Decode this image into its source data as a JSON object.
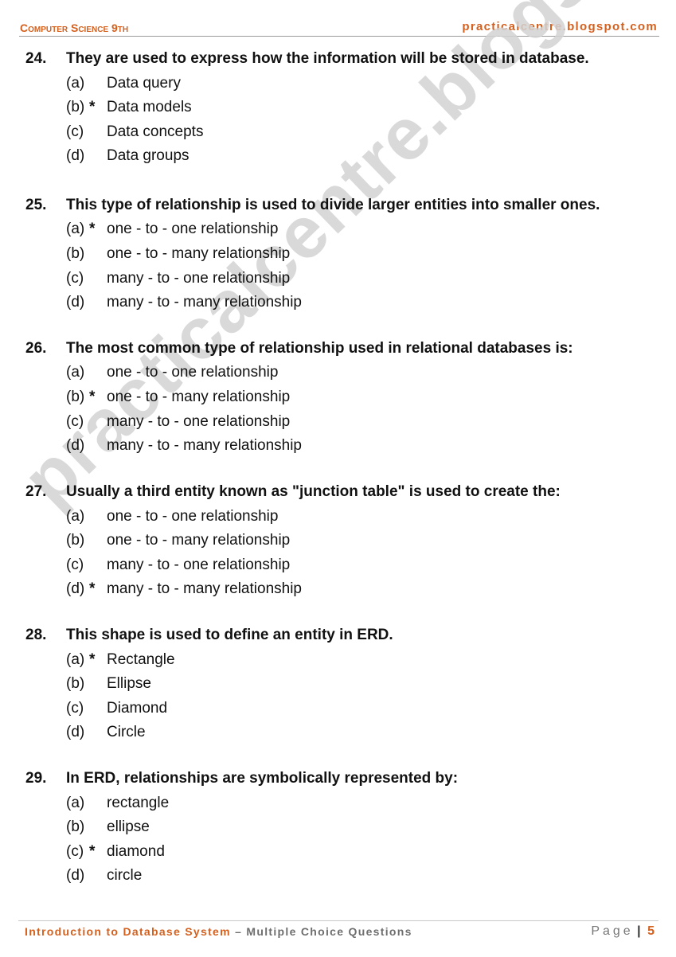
{
  "header": {
    "subject": "Computer Science 9th",
    "website": "practicalcentre.blogspot.com"
  },
  "watermark": "practicalcentre.blogspot.com",
  "colors": {
    "accent": "#d4601e",
    "text": "#111111",
    "muted": "#6e6e6e",
    "watermark": "#d3d3d3"
  },
  "questions": [
    {
      "number": "24.",
      "text": "They are used to express how the information will be stored in database.",
      "options": [
        {
          "label": "(a)",
          "marker": "",
          "text": "Data query"
        },
        {
          "label": "(b)",
          "marker": "*",
          "text": "Data models"
        },
        {
          "label": "(c)",
          "marker": "",
          "text": "Data concepts"
        },
        {
          "label": "(d)",
          "marker": "",
          "text": "Data groups"
        }
      ]
    },
    {
      "number": "25.",
      "text": "This type of relationship is used to divide larger entities into smaller ones.",
      "options": [
        {
          "label": "(a)",
          "marker": "*",
          "text": "one - to - one relationship"
        },
        {
          "label": "(b)",
          "marker": "",
          "text": "one - to - many relationship"
        },
        {
          "label": "(c)",
          "marker": "",
          "text": "many - to - one relationship"
        },
        {
          "label": "(d)",
          "marker": "",
          "text": "many - to - many relationship"
        }
      ]
    },
    {
      "number": "26.",
      "text": "The most common type of relationship used in relational databases is:",
      "options": [
        {
          "label": "(a)",
          "marker": "",
          "text": "one - to - one relationship"
        },
        {
          "label": "(b)",
          "marker": "*",
          "text": "one - to - many relationship"
        },
        {
          "label": "(c)",
          "marker": "",
          "text": "many - to - one relationship"
        },
        {
          "label": "(d)",
          "marker": "",
          "text": "many - to - many relationship"
        }
      ]
    },
    {
      "number": "27.",
      "text": "Usually a third entity known as \"junction table\" is used to create the:",
      "options": [
        {
          "label": "(a)",
          "marker": "",
          "text": "one - to - one relationship"
        },
        {
          "label": "(b)",
          "marker": "",
          "text": "one - to - many relationship"
        },
        {
          "label": "(c)",
          "marker": "",
          "text": "many - to - one relationship"
        },
        {
          "label": "(d)",
          "marker": "*",
          "text": "many - to - many relationship"
        }
      ]
    },
    {
      "number": "28.",
      "text": "This shape is used to define an entity in ERD.",
      "options": [
        {
          "label": "(a)",
          "marker": "*",
          "text": "Rectangle"
        },
        {
          "label": "(b)",
          "marker": "",
          "text": "Ellipse"
        },
        {
          "label": "(c)",
          "marker": "",
          "text": "Diamond"
        },
        {
          "label": "(d)",
          "marker": "",
          "text": "Circle"
        }
      ]
    },
    {
      "number": "29.",
      "text": "In ERD, relationships are symbolically represented by:",
      "options": [
        {
          "label": "(a)",
          "marker": "",
          "text": "rectangle"
        },
        {
          "label": "(b)",
          "marker": "",
          "text": "ellipse"
        },
        {
          "label": "(c)",
          "marker": "*",
          "text": "diamond"
        },
        {
          "label": "(d)",
          "marker": "",
          "text": "circle"
        }
      ]
    }
  ],
  "footer": {
    "topic": "Introduction to Database System",
    "separator": "–",
    "section": "Multiple Choice Questions",
    "page_word": "Page",
    "page_separator": "|",
    "page_number": "5"
  }
}
